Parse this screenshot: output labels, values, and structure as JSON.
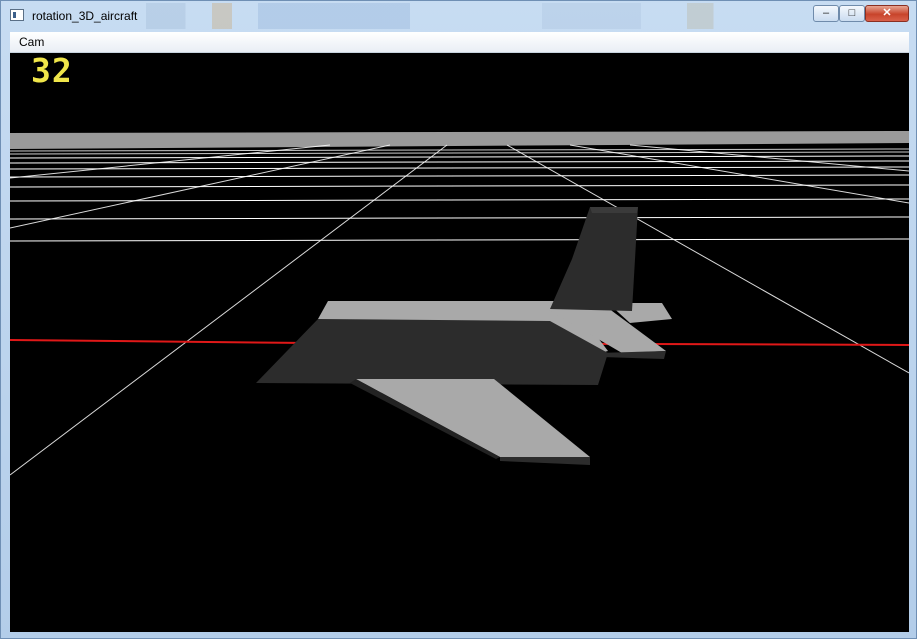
{
  "window": {
    "title": "rotation_3D_aircraft",
    "controls": {
      "minimize": "–",
      "maximize": "□",
      "close": "✕"
    }
  },
  "menu": {
    "items": [
      "Cam"
    ]
  },
  "viewport": {
    "fps_counter": "32",
    "colors": {
      "background": "#000000",
      "grid": "#ffffff",
      "horizon": "#9a9a9a",
      "axis_line": "#e01818",
      "fps": "#f0e64a",
      "fuselage_dark": "#2c2c2c",
      "wing_light": "#a9a9a9"
    }
  },
  "icons": {
    "app": "app-window-icon",
    "minimize": "minimize-icon",
    "maximize": "maximize-icon",
    "close": "close-icon"
  }
}
